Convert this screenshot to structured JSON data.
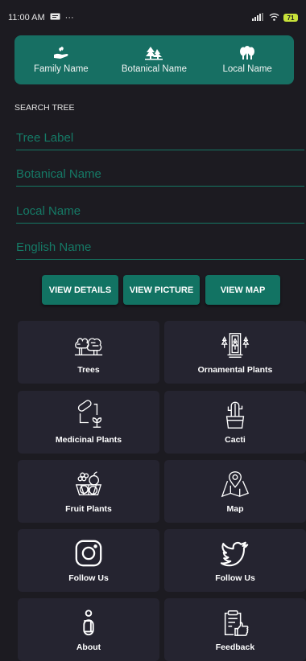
{
  "status": {
    "time": "11:00 AM",
    "dots": "···",
    "battery": "71"
  },
  "nav": {
    "family": "Family Name",
    "botanical": "Botanical Name",
    "local": "Local Name"
  },
  "search": {
    "title": "SEARCH TREE",
    "tree_label": "Tree Label",
    "botanical_name": "Botanical Name",
    "local_name": "Local Name",
    "english_name": "English Name"
  },
  "buttons": {
    "details": "VIEW DETAILS",
    "picture": "VIEW PICTURE",
    "map": "VIEW MAP"
  },
  "grid": {
    "trees": "Trees",
    "ornamental": "Ornamental Plants",
    "medicinal": "Medicinal Plants",
    "cacti": "Cacti",
    "fruit": "Fruit Plants",
    "map": "Map",
    "instagram": "Follow Us",
    "twitter": "Follow Us",
    "about": "About",
    "feedback": "Feedback"
  },
  "colors": {
    "accent": "#127363",
    "background": "#1c1b21",
    "card": "#252430"
  }
}
